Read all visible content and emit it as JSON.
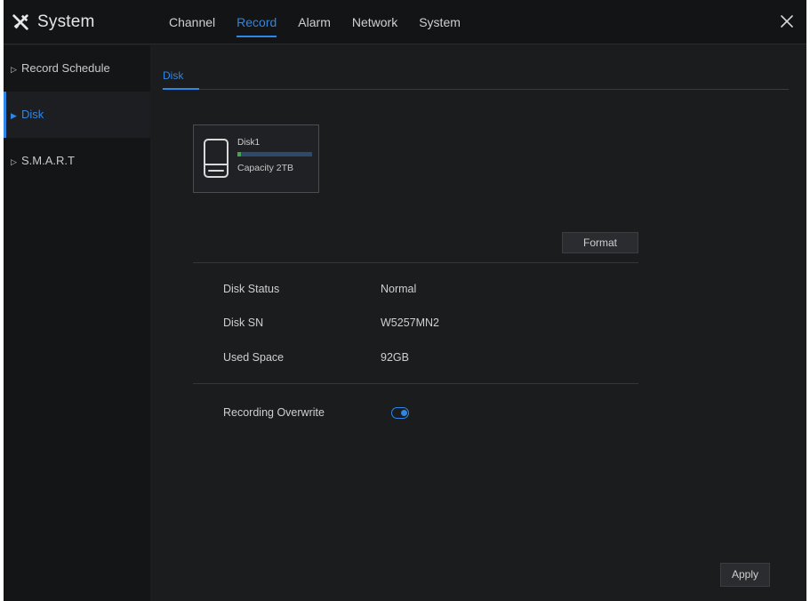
{
  "header": {
    "title": "System",
    "title_icon": "tools-icon",
    "tabs": [
      {
        "label": "Channel",
        "active": false
      },
      {
        "label": "Record",
        "active": true
      },
      {
        "label": "Alarm",
        "active": false
      },
      {
        "label": "Network",
        "active": false
      },
      {
        "label": "System",
        "active": false
      }
    ],
    "close_label": "X"
  },
  "sidebar": {
    "items": [
      {
        "label": "Record Schedule",
        "active": false
      },
      {
        "label": "Disk",
        "active": true
      },
      {
        "label": "S.M.A.R.T",
        "active": false
      }
    ]
  },
  "main": {
    "subtab": "Disk",
    "disk_card": {
      "name": "Disk1",
      "capacity": "Capacity 2TB",
      "usage_fraction": 0.046
    },
    "format_label": "Format",
    "info": [
      {
        "label": "Disk Status",
        "value": "Normal"
      },
      {
        "label": "Disk SN",
        "value": "W5257MN2"
      },
      {
        "label": "Used Space",
        "value": "92GB"
      }
    ],
    "overwrite": {
      "label": "Recording Overwrite",
      "enabled": true
    },
    "apply_label": "Apply"
  },
  "colors": {
    "accent": "#2e86e6",
    "background": "#1b1c1e",
    "sidebar": "#141517",
    "usage_bar": "#3ea84a"
  }
}
